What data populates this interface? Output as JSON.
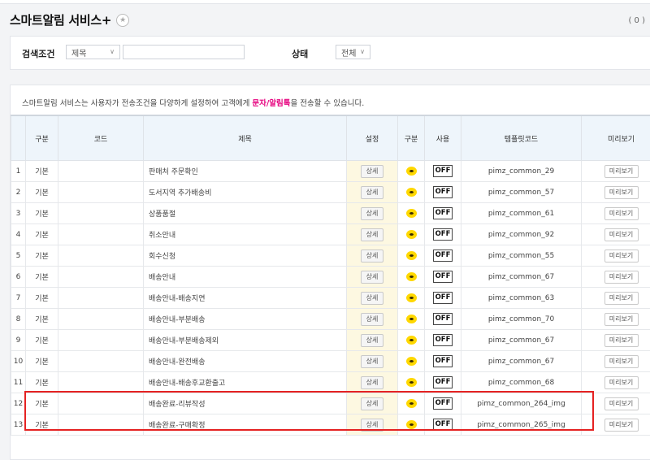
{
  "header": {
    "title": "스마트알림 서비스+",
    "count": "( 0 )"
  },
  "search": {
    "label": "검색조건",
    "field_value": "제목",
    "text_value": "",
    "status_label": "상태",
    "status_value": "전체"
  },
  "notice": {
    "prefix": "스마트알림 서비스는 사용자가 전송조건을 다양하게 설정하여 고객에게 ",
    "highlight": "문자/알림톡",
    "suffix": "을 전송할 수 있습니다."
  },
  "table": {
    "columns": [
      "",
      "구분",
      "코드",
      "제목",
      "설정",
      "구분",
      "사용",
      "템플릿코드",
      "미리보기"
    ],
    "detail_label": "상세",
    "off_label": "OFF",
    "preview_label": "미리보기",
    "rows": [
      {
        "no": "1",
        "type": "기본",
        "code": "",
        "title": "판매처 주문확인",
        "template": "pimz_common_29"
      },
      {
        "no": "2",
        "type": "기본",
        "code": "",
        "title": "도서지역 추가배송비",
        "template": "pimz_common_57"
      },
      {
        "no": "3",
        "type": "기본",
        "code": "",
        "title": "상품품절",
        "template": "pimz_common_61"
      },
      {
        "no": "4",
        "type": "기본",
        "code": "",
        "title": "취소안내",
        "template": "pimz_common_92"
      },
      {
        "no": "5",
        "type": "기본",
        "code": "",
        "title": "회수신청",
        "template": "pimz_common_55"
      },
      {
        "no": "6",
        "type": "기본",
        "code": "",
        "title": "배송안내",
        "template": "pimz_common_67"
      },
      {
        "no": "7",
        "type": "기본",
        "code": "",
        "title": "배송안내-배송지연",
        "template": "pimz_common_63"
      },
      {
        "no": "8",
        "type": "기본",
        "code": "",
        "title": "배송안내-부분배송",
        "template": "pimz_common_70"
      },
      {
        "no": "9",
        "type": "기본",
        "code": "",
        "title": "배송안내-부분배송제외",
        "template": "pimz_common_67"
      },
      {
        "no": "10",
        "type": "기본",
        "code": "",
        "title": "배송안내-완전배송",
        "template": "pimz_common_67"
      },
      {
        "no": "11",
        "type": "기본",
        "code": "",
        "title": "배송안내-배송후교환출고",
        "template": "pimz_common_68"
      },
      {
        "no": "12",
        "type": "기본",
        "code": "",
        "title": "배송완료-리뷰작성",
        "template": "pimz_common_264_img"
      },
      {
        "no": "13",
        "type": "기본",
        "code": "",
        "title": "배송완료-구매확정",
        "template": "pimz_common_265_img"
      }
    ]
  }
}
